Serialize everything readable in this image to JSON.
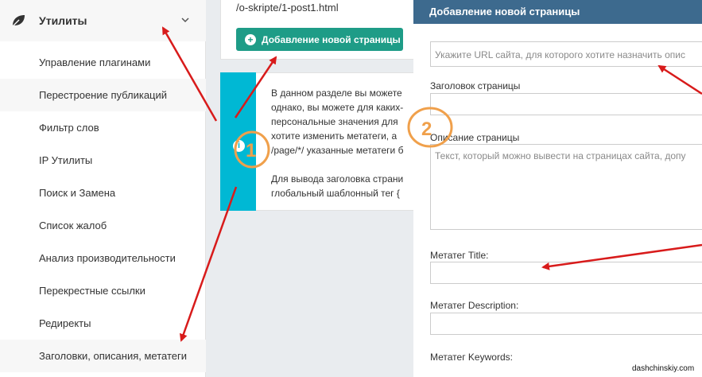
{
  "sidebar": {
    "header_title": "Утилиты",
    "items": [
      "Управление плагинами",
      "Перестроение публикаций",
      "Фильтр слов",
      "IP Утилиты",
      "Поиск и Замена",
      "Список жалоб",
      "Анализ производительности",
      "Перекрестные ссылки",
      "Редиректы",
      "Заголовки, описания, метатеги"
    ]
  },
  "middle": {
    "url_text": "/o-skripte/1-post1.html",
    "add_button_label": "Добавление новой страницы",
    "info_lines": [
      "В данном разделе вы можете",
      "однако, вы можете для каких-",
      "персональные значения для",
      "хотите изменить метатеги, а",
      "/page/*/ указанные метатеги б",
      "",
      "Для вывода заголовка страни",
      "глобальный шаблонный тег {"
    ]
  },
  "modal": {
    "title": "Добавление новой страницы",
    "url_placeholder": "Укажите URL сайта, для которого хотите назначить опис",
    "page_title_label": "Заголовок страницы",
    "page_description_label": "Описание страницы",
    "description_placeholder": "Текст, который можно вывести на страницах сайта, допу",
    "meta_title_label": "Метатег Title:",
    "meta_description_label": "Метатег Description:",
    "meta_keywords_label": "Метатег Keywords:"
  },
  "annotations": {
    "marker_1": "1",
    "marker_2": "2",
    "arrow_color": "#d81b1b",
    "circle_color": "#f0a04b"
  },
  "watermark": "dashchinskiy.com",
  "colors": {
    "accent_button": "#1e9c87",
    "info_bar": "#00b8d4",
    "modal_header": "#3d6a8e"
  }
}
